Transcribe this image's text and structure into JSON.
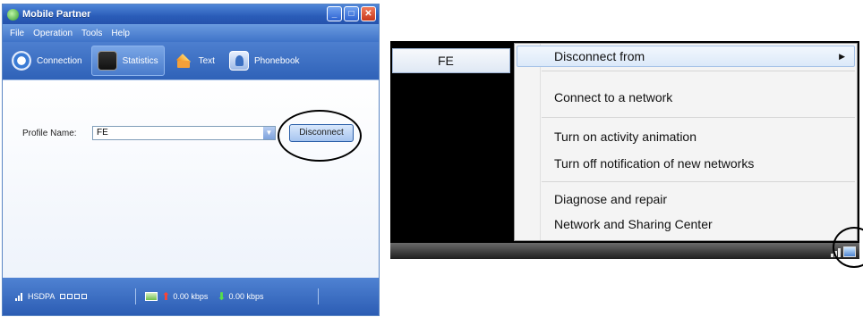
{
  "window": {
    "title": "Mobile Partner",
    "menu": [
      {
        "label": "File"
      },
      {
        "label": "Operation"
      },
      {
        "label": "Tools"
      },
      {
        "label": "Help"
      }
    ],
    "tabs": [
      {
        "label": "Connection",
        "icon": "connection-icon"
      },
      {
        "label": "Statistics",
        "icon": "statistics-icon",
        "active": true
      },
      {
        "label": "Text",
        "icon": "text-icon"
      },
      {
        "label": "Phonebook",
        "icon": "phonebook-icon"
      }
    ],
    "profile": {
      "label": "Profile Name:",
      "value": "FE"
    },
    "disconnect_label": "Disconnect",
    "status": {
      "network": "HSDPA",
      "up_speed": "0.00 kbps",
      "down_speed": "0.00 kbps"
    }
  },
  "context_menu": {
    "network_name": "FE",
    "items": [
      {
        "label": "Disconnect from",
        "has_submenu": true
      },
      {
        "label": "Connect to a network"
      },
      {
        "label": "Turn on activity animation"
      },
      {
        "label": "Turn off notification of new networks"
      },
      {
        "label": "Diagnose and repair"
      },
      {
        "label": "Network and Sharing Center"
      }
    ]
  },
  "colors": {
    "title_blue": "#2a5cb8",
    "menu_highlight": "#dbe9f9",
    "upload_arrow": "#ff4433",
    "download_arrow": "#56e04a"
  }
}
